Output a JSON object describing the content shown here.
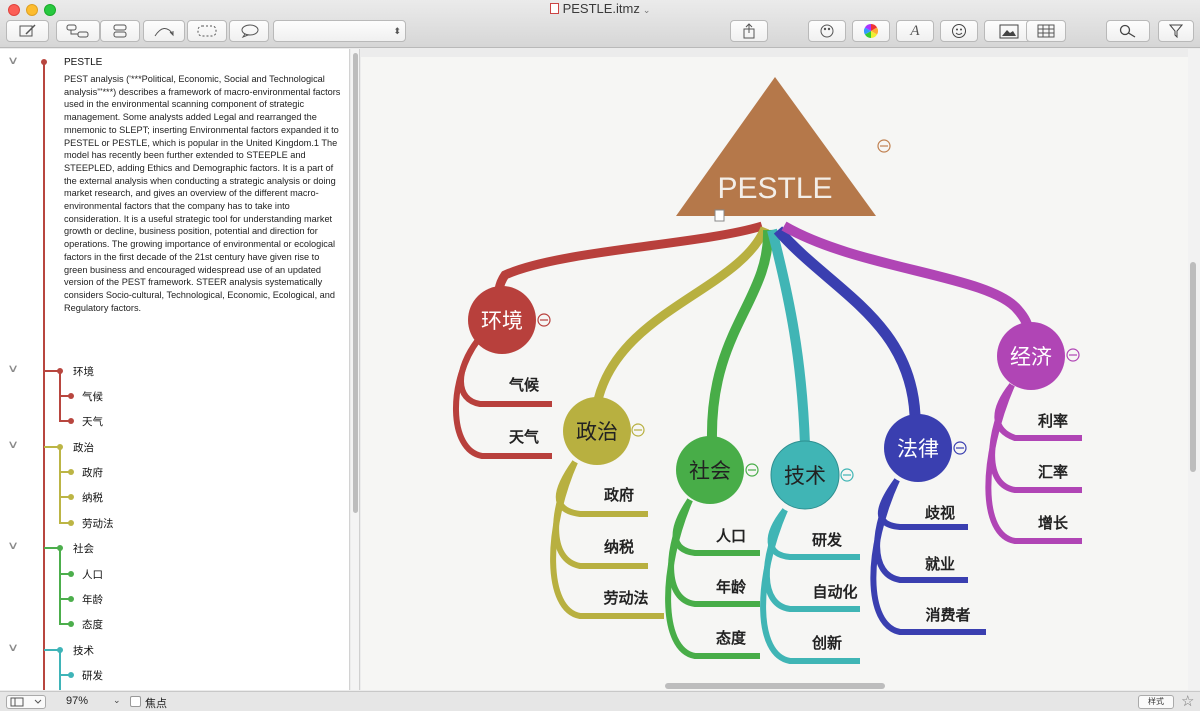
{
  "window": {
    "title": "PESTLE.itmz"
  },
  "outline": {
    "root": {
      "title": "PESTLE",
      "note": "PEST analysis ('***Political, Economic, Social and Technological analysis'''***) describes a framework of macro-environmental factors used in the environmental scanning component of strategic management. Some analysts added Legal and rearranged the mnemonic to SLEPT; inserting Environmental factors expanded it to PESTEL or PESTLE, which is popular in the United Kingdom.1 The model has recently been further extended to STEEPLE and STEEPLED, adding Ethics and Demographic factors. It is a part of the external analysis when conducting a strategic analysis or doing market research, and gives an overview of the different macro-environmental factors that the company has to take into consideration. It is a useful strategic tool for understanding market growth or decline, business position, potential and direction for operations. The growing importance of environmental or ecological factors in the first decade of the 21st century have given rise to green business and encouraged widespread use of an updated version of the PEST framework. STEER analysis systematically considers Socio-cultural, Technological, Economic, Ecological, and Regulatory factors."
    },
    "groups": [
      {
        "label": "环境",
        "color": "#b8463f",
        "children": [
          "气候",
          "天气"
        ]
      },
      {
        "label": "政治",
        "color": "#bcb545",
        "children": [
          "政府",
          "纳税",
          "劳动法"
        ]
      },
      {
        "label": "社会",
        "color": "#4cae4c",
        "children": [
          "人口",
          "年龄",
          "态度"
        ]
      },
      {
        "label": "技术",
        "color": "#3fb4b8",
        "children": [
          "研发"
        ]
      }
    ]
  },
  "mindmap": {
    "root": {
      "label": "PESTLE",
      "color": "#b5784a"
    },
    "topics": [
      {
        "label": "环境",
        "color": "#b8403c",
        "children": [
          "气候",
          "天气"
        ]
      },
      {
        "label": "政治",
        "color": "#b8b040",
        "children": [
          "政府",
          "纳税",
          "劳动法"
        ]
      },
      {
        "label": "社会",
        "color": "#48ad48",
        "children": [
          "人口",
          "年龄",
          "态度"
        ]
      },
      {
        "label": "技术",
        "color": "#40b5b5",
        "children": [
          "研发",
          "自动化",
          "创新"
        ]
      },
      {
        "label": "法律",
        "color": "#3a3fb0",
        "children": [
          "歧视",
          "就业",
          "消费者"
        ]
      },
      {
        "label": "经济",
        "color": "#b045b5",
        "children": [
          "利率",
          "汇率",
          "增长"
        ]
      }
    ]
  },
  "statusbar": {
    "zoom": "97%",
    "focus_label": "焦点",
    "style_label": "样式"
  }
}
